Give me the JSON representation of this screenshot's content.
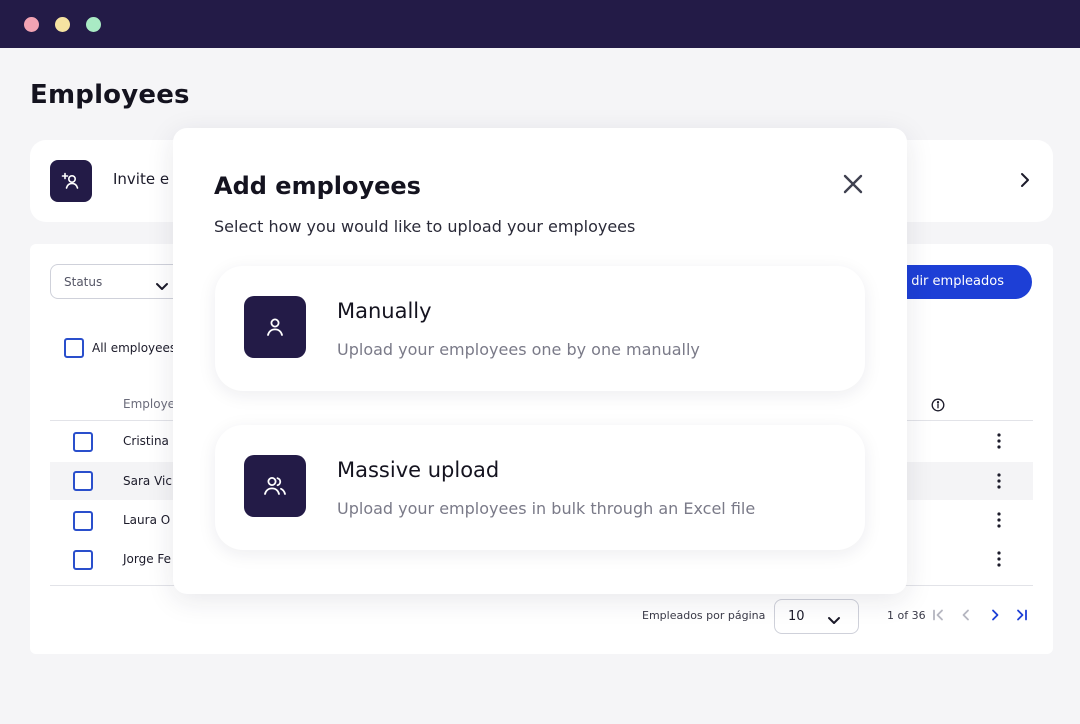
{
  "window": {
    "controls": [
      "close",
      "minimize",
      "maximize"
    ]
  },
  "page": {
    "title": "Employees"
  },
  "invite": {
    "label": "Invite e",
    "icon": "user-plus-icon"
  },
  "filters": {
    "status_label": "Status"
  },
  "toolbar": {
    "add_label": "dir empleados"
  },
  "table": {
    "select_all_label": "All employees",
    "column_header": "Employe",
    "rows": [
      {
        "name": "Cristina"
      },
      {
        "name": "Sara Vic"
      },
      {
        "name": "Laura O"
      },
      {
        "name": "Jorge Fe"
      }
    ]
  },
  "pagination": {
    "per_page_label": "Empleados por página",
    "per_page_value": "10",
    "range": "1 of 36"
  },
  "modal": {
    "title": "Add employees",
    "subtitle": "Select how you would like to upload your employees",
    "options": [
      {
        "title": "Manually",
        "description": "Upload your employees one by one manually",
        "icon": "user-icon"
      },
      {
        "title": "Massive upload",
        "description": "Upload your employees in bulk through an Excel file",
        "icon": "users-icon"
      }
    ]
  },
  "colors": {
    "brand_dark": "#231b47",
    "accent_blue": "#1d3fd6",
    "checkbox_blue": "#2a4fcc"
  }
}
